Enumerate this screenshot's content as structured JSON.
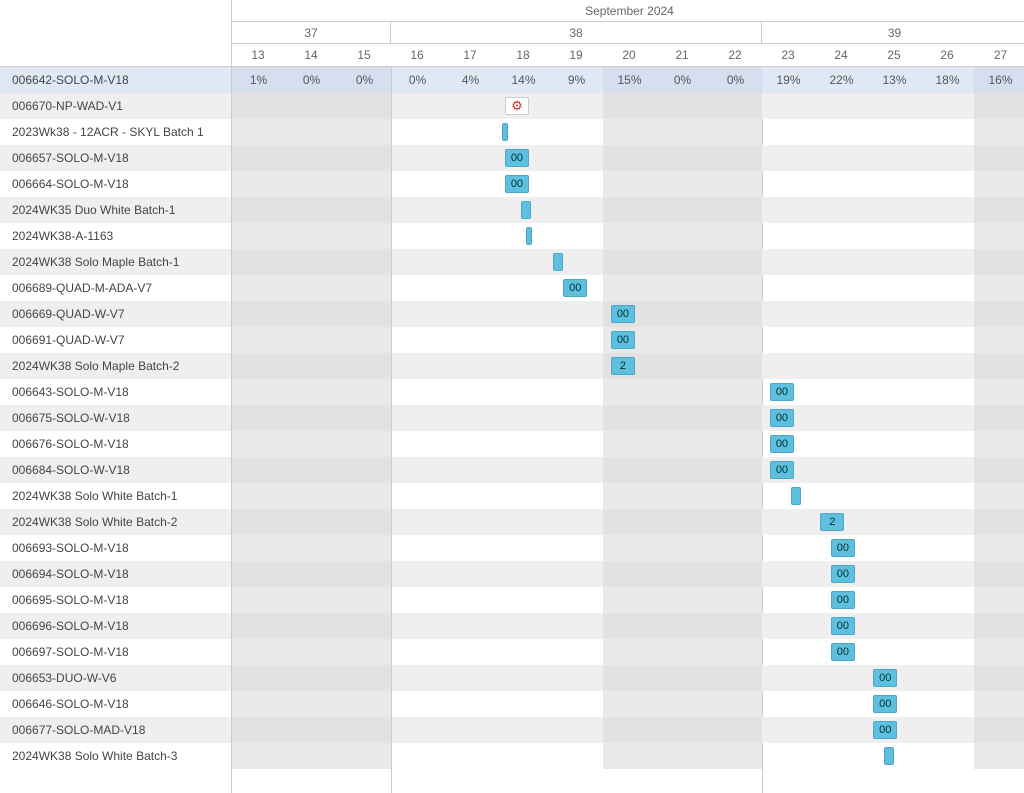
{
  "header": {
    "month": "September 2024",
    "weeks": [
      {
        "label": "37",
        "span": 3
      },
      {
        "label": "38",
        "span": 7
      },
      {
        "label": "39",
        "span": 5
      }
    ],
    "days": [
      "13",
      "14",
      "15",
      "16",
      "17",
      "18",
      "19",
      "20",
      "21",
      "22",
      "23",
      "24",
      "25",
      "26",
      "27"
    ]
  },
  "shaded_day_indices": [
    0,
    1,
    2,
    7,
    8,
    9,
    14
  ],
  "percent_row": {
    "label": "006642-SOLO-M-V18",
    "values": [
      "1%",
      "0%",
      "0%",
      "0%",
      "4%",
      "14%",
      "9%",
      "15%",
      "0%",
      "0%",
      "19%",
      "22%",
      "13%",
      "18%",
      "16%"
    ]
  },
  "rows": [
    {
      "label": "006670-NP-WAD-V1",
      "task": {
        "col": 5,
        "offset": 0.15,
        "kind": "icon",
        "text": "⚙"
      }
    },
    {
      "label": "2023Wk38 - 12ACR - SKYL Batch 1",
      "task": {
        "col": 5,
        "offset": 0.1,
        "kind": "narrow"
      }
    },
    {
      "label": "006657-SOLO-M-V18",
      "task": {
        "col": 5,
        "offset": 0.15,
        "kind": "std",
        "text": "00"
      }
    },
    {
      "label": "006664-SOLO-M-V18",
      "task": {
        "col": 5,
        "offset": 0.15,
        "kind": "std",
        "text": "00"
      }
    },
    {
      "label": "2024WK35 Duo White Batch-1",
      "task": {
        "col": 5,
        "offset": 0.45,
        "kind": "mid"
      }
    },
    {
      "label": "2024WK38-A-1163",
      "task": {
        "col": 5,
        "offset": 0.55,
        "kind": "narrow"
      }
    },
    {
      "label": "2024WK38 Solo Maple Batch-1",
      "task": {
        "col": 6,
        "offset": 0.05,
        "kind": "mid"
      }
    },
    {
      "label": "006689-QUAD-M-ADA-V7",
      "task": {
        "col": 6,
        "offset": 0.25,
        "kind": "std",
        "text": "00"
      }
    },
    {
      "label": "006669-QUAD-W-V7",
      "task": {
        "col": 7,
        "offset": 0.15,
        "kind": "std",
        "text": "00"
      }
    },
    {
      "label": "006691-QUAD-W-V7",
      "task": {
        "col": 7,
        "offset": 0.15,
        "kind": "std",
        "text": "00"
      }
    },
    {
      "label": "2024WK38 Solo Maple Batch-2",
      "task": {
        "col": 7,
        "offset": 0.15,
        "kind": "std",
        "text": "2"
      }
    },
    {
      "label": "006643-SOLO-M-V18",
      "task": {
        "col": 10,
        "offset": 0.15,
        "kind": "std",
        "text": "00"
      }
    },
    {
      "label": "006675-SOLO-W-V18",
      "task": {
        "col": 10,
        "offset": 0.15,
        "kind": "std",
        "text": "00"
      }
    },
    {
      "label": "006676-SOLO-M-V18",
      "task": {
        "col": 10,
        "offset": 0.15,
        "kind": "std",
        "text": "00"
      }
    },
    {
      "label": "006684-SOLO-W-V18",
      "task": {
        "col": 10,
        "offset": 0.15,
        "kind": "std",
        "text": "00"
      }
    },
    {
      "label": "2024WK38 Solo White Batch-1",
      "task": {
        "col": 10,
        "offset": 0.55,
        "kind": "mid"
      }
    },
    {
      "label": "2024WK38 Solo White Batch-2",
      "task": {
        "col": 11,
        "offset": 0.1,
        "kind": "std",
        "text": "2"
      }
    },
    {
      "label": "006693-SOLO-M-V18",
      "task": {
        "col": 11,
        "offset": 0.3,
        "kind": "std",
        "text": "00"
      }
    },
    {
      "label": "006694-SOLO-M-V18",
      "task": {
        "col": 11,
        "offset": 0.3,
        "kind": "std",
        "text": "00"
      }
    },
    {
      "label": "006695-SOLO-M-V18",
      "task": {
        "col": 11,
        "offset": 0.3,
        "kind": "std",
        "text": "00"
      }
    },
    {
      "label": "006696-SOLO-M-V18",
      "task": {
        "col": 11,
        "offset": 0.3,
        "kind": "std",
        "text": "00"
      }
    },
    {
      "label": "006697-SOLO-M-V18",
      "task": {
        "col": 11,
        "offset": 0.3,
        "kind": "std",
        "text": "00"
      }
    },
    {
      "label": "006653-DUO-W-V6",
      "task": {
        "col": 12,
        "offset": 0.1,
        "kind": "std",
        "text": "00"
      }
    },
    {
      "label": "006646-SOLO-M-V18",
      "task": {
        "col": 12,
        "offset": 0.1,
        "kind": "std",
        "text": "00"
      }
    },
    {
      "label": "006677-SOLO-MAD-V18",
      "task": {
        "col": 12,
        "offset": 0.1,
        "kind": "std",
        "text": "00"
      }
    },
    {
      "label": "2024WK38 Solo White Batch-3",
      "task": {
        "col": 12,
        "offset": 0.3,
        "kind": "mid"
      }
    }
  ],
  "icons": {
    "settings_glyph": "⚙"
  }
}
